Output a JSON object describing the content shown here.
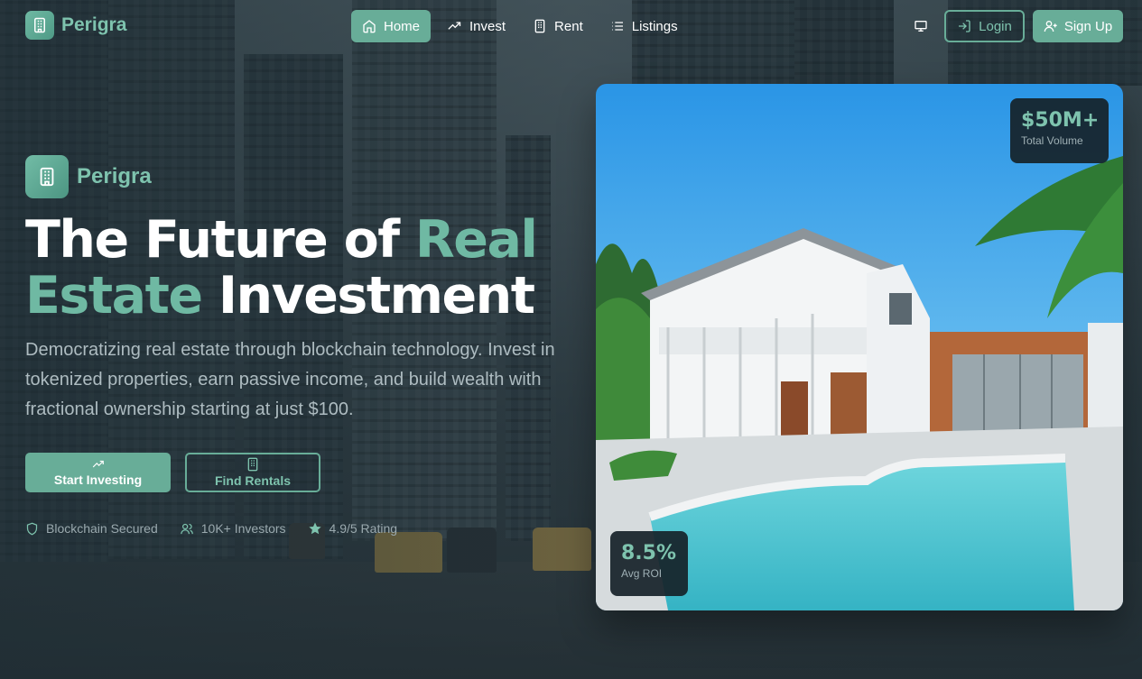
{
  "brand": {
    "name": "Perigra"
  },
  "nav": {
    "links": [
      {
        "label": "Home",
        "icon": "home-icon",
        "active": true
      },
      {
        "label": "Invest",
        "icon": "trending-up-icon",
        "active": false
      },
      {
        "label": "Rent",
        "icon": "building-icon",
        "active": false
      },
      {
        "label": "Listings",
        "icon": "list-icon",
        "active": false
      }
    ],
    "login_label": "Login",
    "signup_label": "Sign Up"
  },
  "hero": {
    "brand_name": "Perigra",
    "headline_part1": "The Future of ",
    "headline_accent": "Real Estate",
    "headline_part2": " Investment",
    "subtitle": "Democratizing real estate through blockchain technology. Invest in tokenized properties, earn passive income, and build wealth with fractional ownership starting at just $100.",
    "primary_cta": "Start Investing",
    "secondary_cta": "Find Rentals",
    "trust": [
      {
        "label": "Blockchain Secured",
        "icon": "shield-icon"
      },
      {
        "label": "10K+ Investors",
        "icon": "users-icon"
      },
      {
        "label": "4.9/5 Rating",
        "icon": "star-icon"
      }
    ]
  },
  "stats": {
    "volume": {
      "value": "$50M+",
      "label": "Total Volume"
    },
    "roi": {
      "value": "8.5%",
      "label": "Avg ROI"
    }
  },
  "colors": {
    "accent": "#68ad98",
    "accent_text": "#7ec3ae",
    "dark_card": "#16222b"
  }
}
